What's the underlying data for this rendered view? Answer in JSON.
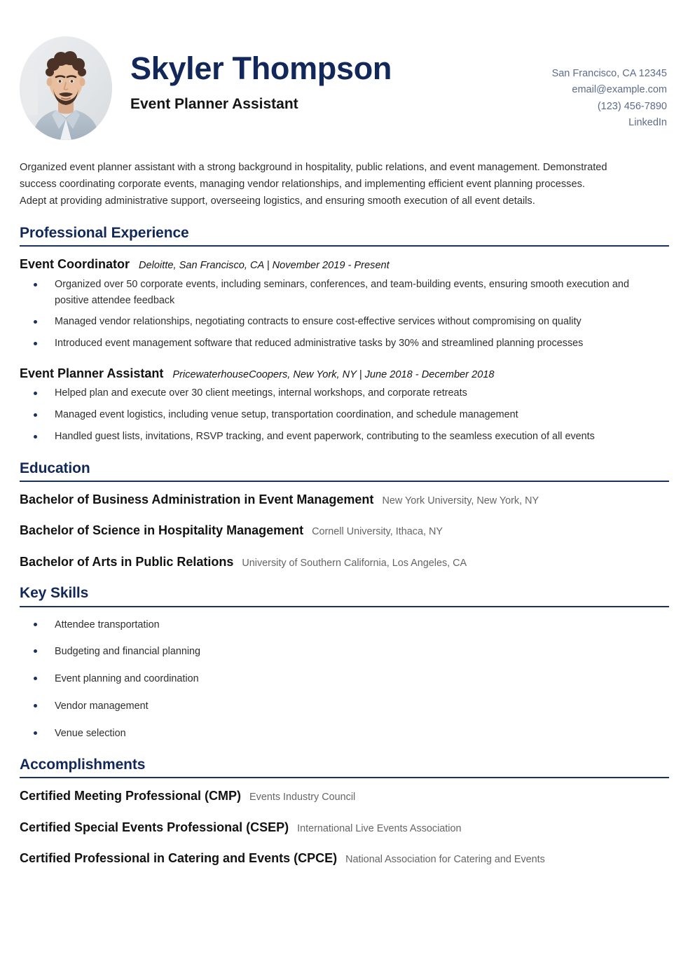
{
  "theme": {
    "accent_navy": "#12275a",
    "rule_navy": "#1b3160",
    "body_text": "#2e2e2e",
    "muted_text": "#656565",
    "contact_text": "#5d6c8a",
    "page_background": "#ffffff"
  },
  "header": {
    "full_name": "Skyler Thompson",
    "job_subtitle": "Event Planner Assistant",
    "photo_alt": "profile-photo",
    "contact": {
      "location": "San Francisco, CA 12345",
      "email": "email@example.com",
      "phone": "(123) 456-7890",
      "linkedin": "LinkedIn"
    }
  },
  "summary": {
    "text": "Organized event planner assistant with a strong background in hospitality, public relations, and event management. Demonstrated success coordinating corporate events, managing vendor relationships, and implementing efficient event planning processes. Adept at providing administrative support, overseeing logistics, and ensuring smooth execution of all event details."
  },
  "sections": {
    "experience": {
      "title": "Professional Experience",
      "jobs": [
        {
          "title": "Event Coordinator",
          "meta": "Deloitte, San Francisco, CA | November 2019 - Present",
          "bullets": [
            "Organized over 50 corporate events, including seminars, conferences, and team-building events, ensuring smooth execution and positive attendee feedback",
            "Managed vendor relationships, negotiating contracts to ensure cost-effective services without compromising on quality",
            "Introduced event management software that reduced administrative tasks by 30% and streamlined planning processes"
          ]
        },
        {
          "title": "Event Planner Assistant",
          "meta": "PricewaterhouseCoopers, New York, NY | June 2018 - December 2018",
          "bullets": [
            "Helped plan and execute over 30 client meetings, internal workshops, and corporate retreats",
            "Managed event logistics, including venue setup, transportation coordination, and schedule management",
            "Handled guest lists, invitations, RSVP tracking, and event paperwork, contributing to the seamless execution of all events"
          ]
        }
      ]
    },
    "education": {
      "title": "Education",
      "entries": [
        {
          "degree": "Bachelor of Business Administration in Event Management",
          "institution": "New York University, New York, NY"
        },
        {
          "degree": "Bachelor of Science in Hospitality Management",
          "institution": "Cornell University, Ithaca, NY"
        },
        {
          "degree": "Bachelor of Arts in Public Relations",
          "institution": "University of Southern California, Los Angeles, CA"
        }
      ]
    },
    "skills": {
      "title": "Key Skills",
      "items": [
        "Attendee transportation",
        "Budgeting and financial planning",
        "Event planning and coordination",
        "Vendor management",
        "Venue selection"
      ]
    },
    "accomplishments": {
      "title": "Accomplishments",
      "entries": [
        {
          "name": "Certified Meeting Professional (CMP)",
          "issuer": "Events Industry Council"
        },
        {
          "name": "Certified Special Events Professional (CSEP)",
          "issuer": "International Live Events Association"
        },
        {
          "name": "Certified Professional in Catering and Events (CPCE)",
          "issuer": "National Association for Catering and Events"
        }
      ]
    }
  }
}
